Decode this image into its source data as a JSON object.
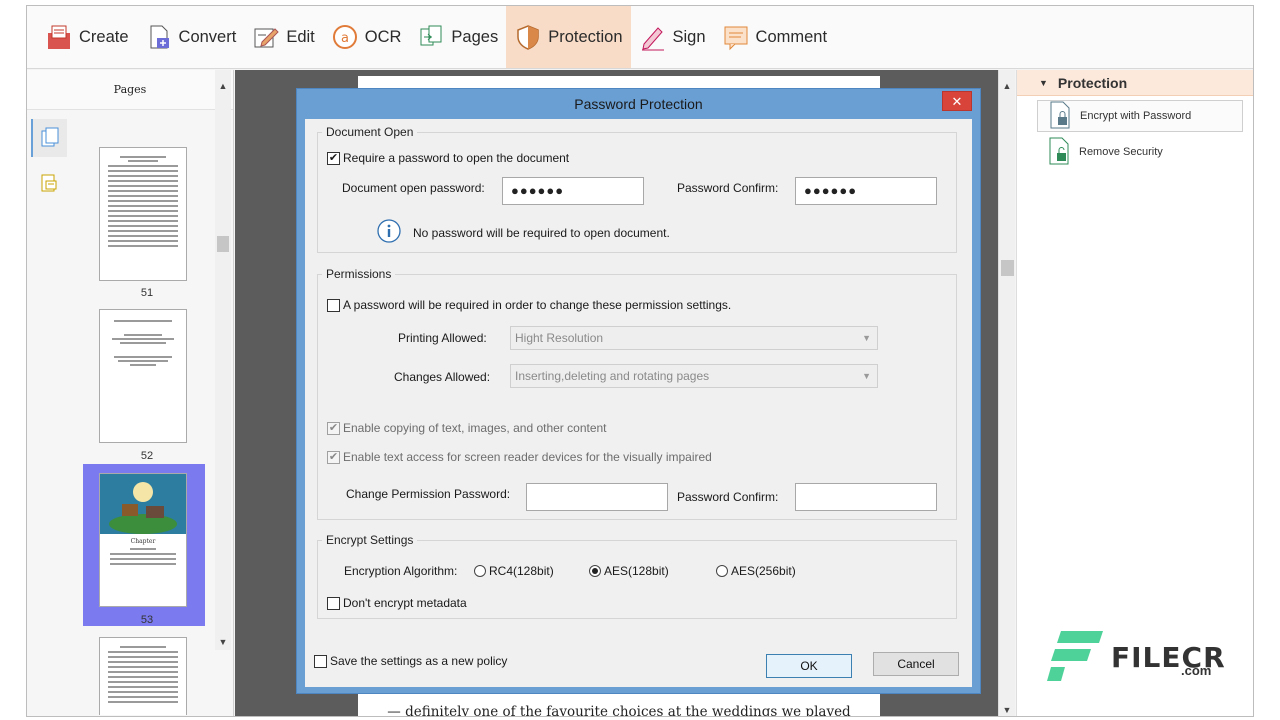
{
  "toolbar": {
    "items": [
      {
        "label": "Create",
        "icon": "create-icon"
      },
      {
        "label": "Convert",
        "icon": "convert-icon"
      },
      {
        "label": "Edit",
        "icon": "edit-icon"
      },
      {
        "label": "OCR",
        "icon": "ocr-icon"
      },
      {
        "label": "Pages",
        "icon": "pages-icon"
      },
      {
        "label": "Protection",
        "icon": "shield-icon",
        "active": true
      },
      {
        "label": "Sign",
        "icon": "pen-icon"
      },
      {
        "label": "Comment",
        "icon": "comment-icon"
      }
    ],
    "active_color": "#f8dcc7"
  },
  "left_panel": {
    "title": "Pages",
    "thumbnails": [
      {
        "page": "51"
      },
      {
        "page": "52"
      },
      {
        "page": "53",
        "selected": true
      },
      {
        "page": ""
      }
    ],
    "selection_color": "#7b7bef"
  },
  "document": {
    "bottom_text": "— definitely one of the favourite choices at the weddings we played"
  },
  "right_panel": {
    "section_title": "Protection",
    "items": [
      {
        "label": "Encrypt with Password",
        "icon": "lock-document-icon",
        "selected": true
      },
      {
        "label": "Remove Security",
        "icon": "unlock-document-icon"
      }
    ]
  },
  "dialog": {
    "title": "Password Protection",
    "close_symbol": "✕",
    "document_open": {
      "legend": "Document Open",
      "require_label": "Require a password to open the document",
      "require_checked": true,
      "open_password_label": "Document open password:",
      "open_password_value": "●●●●●●",
      "confirm_label": "Password Confirm:",
      "confirm_value": "●●●●●●",
      "info_text": "No password will be required to open document."
    },
    "permissions": {
      "legend": "Permissions",
      "require_label": "A password will be required in order to change these permission settings.",
      "require_checked": false,
      "printing_label": "Printing Allowed:",
      "printing_value": "Hight Resolution",
      "changes_label": "Changes Allowed:",
      "changes_value": "Inserting,deleting and rotating pages",
      "copy_label": "Enable copying of text, images, and other content",
      "screenreader_label": "Enable text access for screen reader devices for the visually impaired",
      "change_pwd_label": "Change Permission Password:",
      "change_pwd_value": "",
      "confirm_label": "Password Confirm:",
      "confirm_value": ""
    },
    "encrypt": {
      "legend": "Encrypt Settings",
      "algorithm_label": "Encryption Algorithm:",
      "options": [
        "RC4(128bit)",
        "AES(128bit)",
        "AES(256bit)"
      ],
      "selected": "AES(128bit)",
      "metadata_label": "Don't encrypt metadata",
      "metadata_checked": false
    },
    "save_policy_label": "Save the settings as a new policy",
    "ok_label": "OK",
    "cancel_label": "Cancel",
    "frame_color": "#6a9fd4"
  },
  "watermark": {
    "text": "FILECR",
    "sub": ".com",
    "accent": "#4fd19a"
  }
}
